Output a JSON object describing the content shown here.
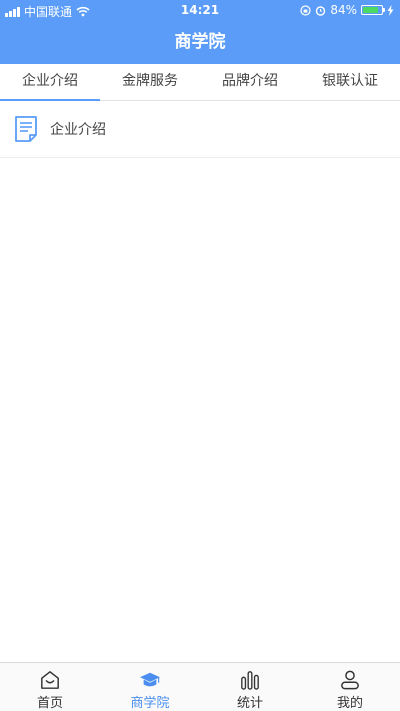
{
  "status_bar": {
    "carrier": "中国联通",
    "time": "14:21",
    "battery_percent": "84%",
    "battery_level": 0.84,
    "icons": [
      "signal-icon",
      "wifi-icon",
      "orientation-lock-icon",
      "alarm-icon",
      "battery-icon",
      "charging-icon"
    ]
  },
  "nav": {
    "title": "商学院"
  },
  "tabs": [
    {
      "label": "企业介绍",
      "active": true
    },
    {
      "label": "金牌服务",
      "active": false
    },
    {
      "label": "品牌介绍",
      "active": false
    },
    {
      "label": "银联认证",
      "active": false
    }
  ],
  "list": [
    {
      "label": "企业介绍",
      "icon": "document-icon"
    }
  ],
  "tab_bar": [
    {
      "label": "首页",
      "icon": "home-icon",
      "active": false
    },
    {
      "label": "商学院",
      "icon": "graduation-cap-icon",
      "active": true
    },
    {
      "label": "统计",
      "icon": "statistics-icon",
      "active": false
    },
    {
      "label": "我的",
      "icon": "profile-icon",
      "active": false
    }
  ],
  "colors": {
    "primary": "#5a9cf8",
    "active_text": "#4a8ff0",
    "text": "#444444",
    "battery": "#4cd964"
  }
}
